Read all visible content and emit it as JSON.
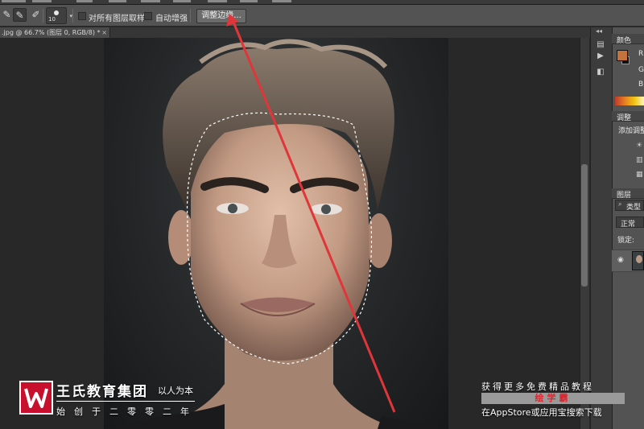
{
  "options_bar": {
    "brush_size": "10",
    "sample_all_layers_label": "对所有图层取样",
    "auto_enhance_label": "自动增强",
    "refine_edge_button": "调整边缘..."
  },
  "document": {
    "tab_title": ".jpg @ 66.7% (图层 0, RGB/8) *",
    "tab_close": "×"
  },
  "panels": {
    "color_tab": "颜色",
    "color_channels": [
      "R",
      "G",
      "B"
    ],
    "adjustments_tab": "调整",
    "adjustments_add_label": "添加调整",
    "layers_tab": "图层",
    "layers_filter": "类型",
    "blend_mode": "正常",
    "lock_label": "锁定:",
    "foreground_color": "#c4733d",
    "background_color": "#111111"
  },
  "watermark": {
    "brand": "王氏教育集团",
    "tagline": "以人为本",
    "motto": "始创于二零零二年",
    "ad_top": "获得更多免费精品教程",
    "ad_brand": "绘学霸",
    "ad_bottom": "在AppStore或应用宝搜索下载"
  },
  "annotation": {
    "arrow_color": "#e0363a",
    "points_to": "refine-edge-button"
  }
}
